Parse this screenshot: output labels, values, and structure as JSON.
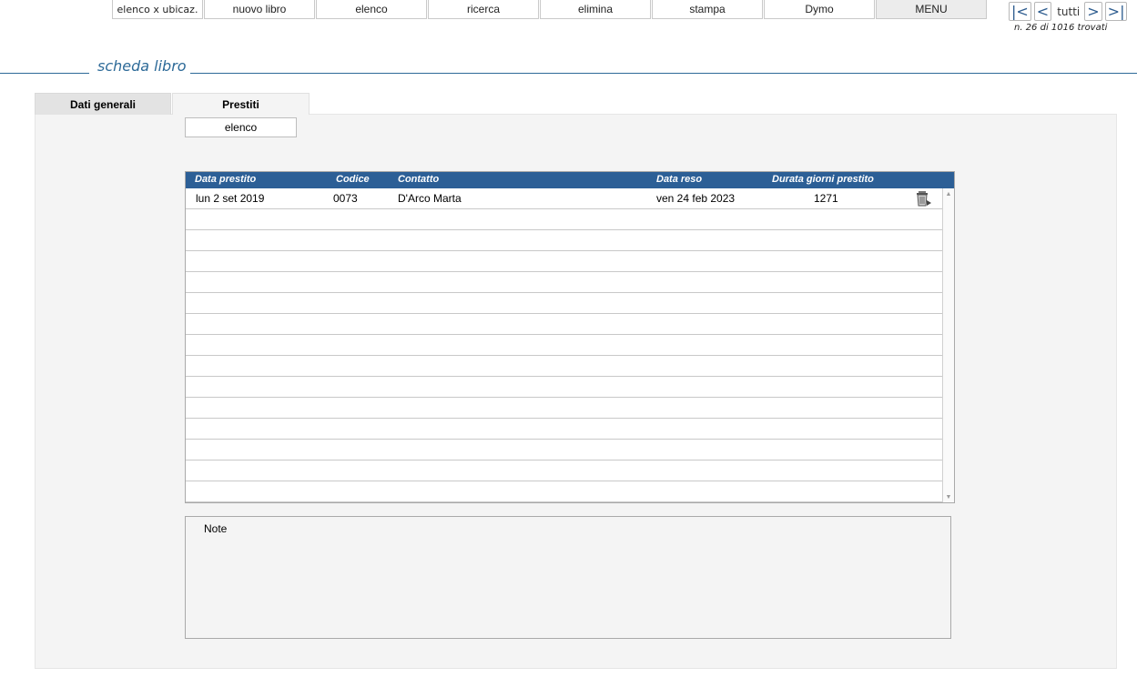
{
  "toolbar": {
    "buttons": [
      "elenco x ubicaz.",
      "nuovo libro",
      "elenco",
      "ricerca",
      "elimina",
      "stampa",
      "Dymo",
      "MENU"
    ]
  },
  "navigation": {
    "first": "|<",
    "prev": "<",
    "all": "tutti",
    "next": ">",
    "last": ">|",
    "record_status": "n. 26 di  1016 trovati"
  },
  "page": {
    "title": "scheda libro"
  },
  "tabs": [
    {
      "label": "Dati generali",
      "active": false
    },
    {
      "label": "Prestiti",
      "active": true
    }
  ],
  "loans": {
    "list_button": "elenco",
    "columns": [
      "Data prestito",
      "Codice",
      "Contatto",
      "Data reso",
      "Durata giorni prestito"
    ],
    "rows": [
      {
        "loan_date": "lun 2 set 2019",
        "code": "0073",
        "contact": "D'Arco Marta",
        "return_date": "ven 24 feb 2023",
        "duration": "1271",
        "action_icon": "trash-icon"
      }
    ],
    "empty_rows": 15
  },
  "notes": {
    "label": "Note",
    "value": ""
  },
  "colors": {
    "accent": "#2d6a98",
    "header_bg": "#2c5f96",
    "panel_bg": "#f4f4f4"
  }
}
